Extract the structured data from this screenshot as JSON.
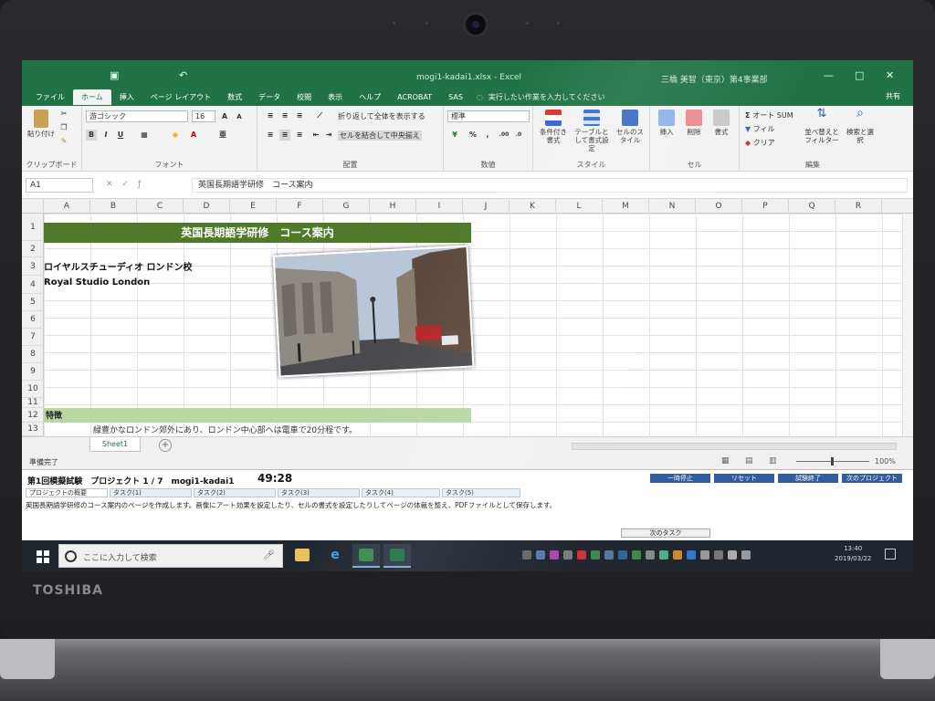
{
  "window": {
    "doc_title": "mogi1-kadai1.xlsx - Excel",
    "user": "三橋 美智（東京）第4事業部",
    "share": "共有",
    "ctrl_min": "—",
    "ctrl_max": "□",
    "ctrl_close": "✕"
  },
  "tabs": [
    "ファイル",
    "ホーム",
    "挿入",
    "ページ レイアウト",
    "数式",
    "データ",
    "校閲",
    "表示",
    "ヘルプ",
    "ACROBAT",
    "SAS"
  ],
  "tell_me": "実行したい作業を入力してください",
  "ribbon": {
    "clipboard": {
      "label": "クリップボード",
      "paste": "貼り付け"
    },
    "font": {
      "label": "フォント",
      "name": "游ゴシック",
      "size": "16",
      "bold": "B",
      "italic": "I",
      "underline": "U"
    },
    "alignment": {
      "label": "配置",
      "wrap": "折り返して全体を表示する",
      "merge": "セルを結合して中央揃え"
    },
    "number": {
      "label": "数値",
      "format": "標準",
      "percent": "%"
    },
    "styles": {
      "label": "スタイル",
      "cond": "条件付き書式",
      "table": "テーブルとして書式設定",
      "cell": "セルのスタイル"
    },
    "cells": {
      "label": "セル",
      "insert": "挿入",
      "delete": "削除",
      "format": "書式"
    },
    "editing": {
      "label": "編集",
      "autosum": "オート SUM",
      "fill": "フィル",
      "clear": "クリア",
      "sort": "並べ替えとフィルター",
      "find": "検索と選択"
    }
  },
  "namebox": "A1",
  "formula": "英国長期語学研修　コース案内",
  "columns": [
    "A",
    "B",
    "C",
    "D",
    "E",
    "F",
    "G",
    "H",
    "I",
    "J",
    "K",
    "L",
    "M",
    "N",
    "O",
    "P",
    "Q",
    "R"
  ],
  "rows": [
    "1",
    "2",
    "3",
    "4",
    "5",
    "6",
    "7",
    "8",
    "9",
    "10",
    "11",
    "12",
    "13"
  ],
  "cells": {
    "title": "英国長期語学研修　コース案内",
    "a3": "ロイヤルスチューディオ ロンドン校",
    "a4": "Royal Studio London",
    "a12": "特徴",
    "b13": "緑豊かなロンドン郊外にあり、ロンドン中心部へは電車で20分程です。"
  },
  "sheet_tab": "Sheet1",
  "add_sheet": "+",
  "status": {
    "ready": "準備完了",
    "zoom": "100%"
  },
  "exam": {
    "info": "第1回模擬試験　プロジェクト 1 / 7　mogi1-kadai1",
    "timer": "49:28",
    "buttons": [
      "一時停止",
      "リセット",
      "試験終了",
      "次のプロジェクト"
    ],
    "task_tabs": [
      "プロジェクトの概要",
      "タスク(1)",
      "タスク(2)",
      "タスク(3)",
      "タスク(4)",
      "タスク(5)"
    ],
    "description": "英国長期語学研修のコース案内のページを作成します。画像にアート効果を設定したり、セルの書式を設定したりしてページの体裁を整え、PDFファイルとして保存します。",
    "next_task": "次のタスク"
  },
  "taskbar": {
    "search_placeholder": "ここに入力して検索",
    "time": "13:40",
    "date": "2019/03/22"
  },
  "laptop_brand": "TOSHIBA",
  "colors": {
    "excel_green": "#217346",
    "title_band": "#4f7a2a",
    "feature_band": "#b8d7a3",
    "exam_button": "#2f5d9e"
  }
}
